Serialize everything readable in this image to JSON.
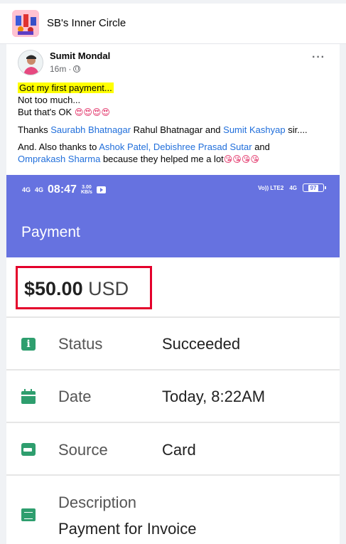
{
  "group": {
    "title": "SB's Inner Circle"
  },
  "post": {
    "author": "Sumit Mondal",
    "time": "16m",
    "separator": "·",
    "more": "···",
    "line1": "Got my first payment...",
    "line2": "Not too much...",
    "line3": "But that's OK",
    "line3_emoji": "😍😍😍😍",
    "thanks_prefix": "Thanks",
    "thanks_link1": "Saurabh Bhatnagar",
    "thanks_middle": "Rahul Bhatnagar and",
    "thanks_link2": "Sumit Kashyap",
    "thanks_suffix": "sir....",
    "also_prefix": "And. Also thanks to",
    "also_link1": "Ashok Patel",
    "also_comma": ",",
    "also_link2": "Debishree Prasad Sutar",
    "also_and": "and",
    "also_link3": "Omprakash Sharma",
    "also_suffix": "because they helped me a lot",
    "also_emoji": "😘😘😘😘"
  },
  "phone": {
    "signal1": "4G",
    "signal2": "4G",
    "clock": "08:47",
    "speed_value": "3.00",
    "speed_unit": "KB/s",
    "volte": "Vo)) LTE2",
    "net": "4G",
    "battery": "97",
    "appbar_title": "Payment",
    "amount": "$50.00",
    "currency": "USD",
    "rows": [
      {
        "label": "Status",
        "value": "Succeeded",
        "icon": "info-icon"
      },
      {
        "label": "Date",
        "value": "Today, 8:22AM",
        "icon": "calendar-icon"
      },
      {
        "label": "Source",
        "value": "Card",
        "icon": "wallet-icon"
      },
      {
        "label": "Description",
        "value": "Payment for Invoice",
        "icon": "receipt-icon"
      }
    ]
  },
  "colors": {
    "link": "#216fdb",
    "highlight": "#ffff00",
    "appbar": "#6672e0",
    "icon_green": "#2e9e6e",
    "amount_border": "#e4002b"
  }
}
